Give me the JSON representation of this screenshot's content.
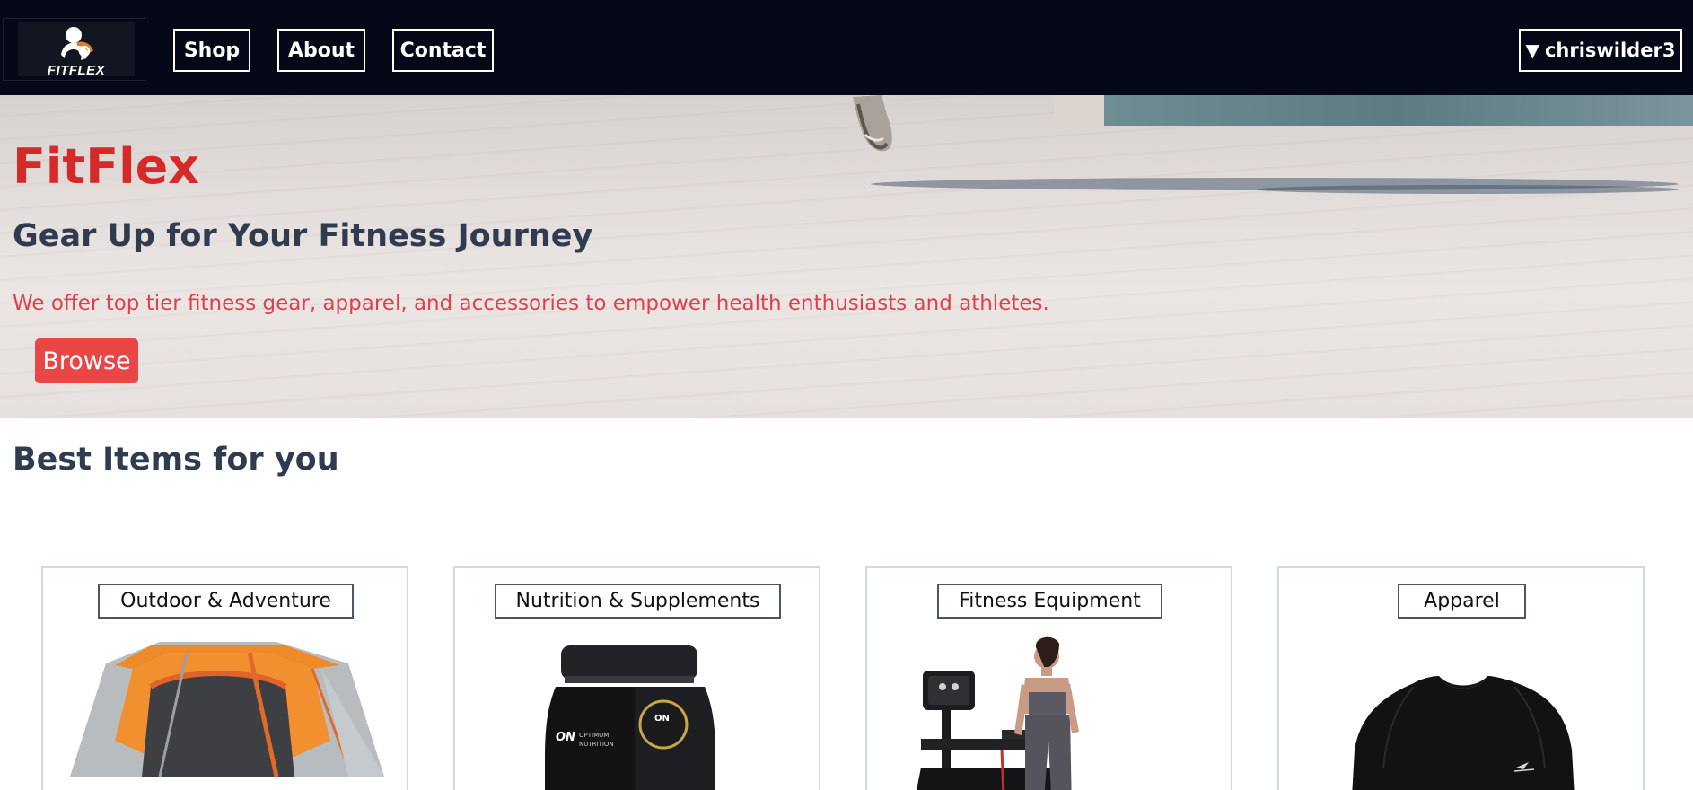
{
  "brand": {
    "logo_text": "FITFLEX"
  },
  "nav": {
    "shop": "Shop",
    "about": "About",
    "contact": "Contact",
    "user_caret": "▼",
    "username": "chriswilder3"
  },
  "hero": {
    "title": "FitFlex",
    "subtitle": "Gear Up for Your Fitness Journey",
    "description": "We offer top tier fitness gear, apparel, and accessories to empower health enthusiasts and athletes.",
    "cta_label": "Browse"
  },
  "section": {
    "title": "Best Items for you",
    "categories": [
      {
        "label": "Outdoor & Adventure",
        "image_icon": "tent-icon"
      },
      {
        "label": "Nutrition & Supplements",
        "image_icon": "supplement-jar-icon"
      },
      {
        "label": "Fitness Equipment",
        "image_icon": "treadmill-icon"
      },
      {
        "label": "Apparel",
        "image_icon": "tshirt-icon"
      }
    ]
  },
  "colors": {
    "navbar_bg": "#050816",
    "brand_red": "#d62a2a",
    "cta_red": "#ea4646",
    "text_dark": "#2f3b4f"
  }
}
